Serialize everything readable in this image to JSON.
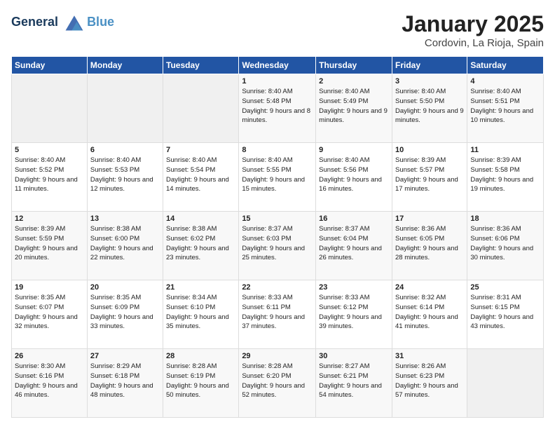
{
  "logo": {
    "line1": "General",
    "line2": "Blue"
  },
  "title": "January 2025",
  "location": "Cordovin, La Rioja, Spain",
  "days_of_week": [
    "Sunday",
    "Monday",
    "Tuesday",
    "Wednesday",
    "Thursday",
    "Friday",
    "Saturday"
  ],
  "weeks": [
    [
      {
        "day": "",
        "sunrise": "",
        "sunset": "",
        "daylight": ""
      },
      {
        "day": "",
        "sunrise": "",
        "sunset": "",
        "daylight": ""
      },
      {
        "day": "",
        "sunrise": "",
        "sunset": "",
        "daylight": ""
      },
      {
        "day": "1",
        "sunrise": "Sunrise: 8:40 AM",
        "sunset": "Sunset: 5:48 PM",
        "daylight": "Daylight: 9 hours and 8 minutes."
      },
      {
        "day": "2",
        "sunrise": "Sunrise: 8:40 AM",
        "sunset": "Sunset: 5:49 PM",
        "daylight": "Daylight: 9 hours and 9 minutes."
      },
      {
        "day": "3",
        "sunrise": "Sunrise: 8:40 AM",
        "sunset": "Sunset: 5:50 PM",
        "daylight": "Daylight: 9 hours and 9 minutes."
      },
      {
        "day": "4",
        "sunrise": "Sunrise: 8:40 AM",
        "sunset": "Sunset: 5:51 PM",
        "daylight": "Daylight: 9 hours and 10 minutes."
      }
    ],
    [
      {
        "day": "5",
        "sunrise": "Sunrise: 8:40 AM",
        "sunset": "Sunset: 5:52 PM",
        "daylight": "Daylight: 9 hours and 11 minutes."
      },
      {
        "day": "6",
        "sunrise": "Sunrise: 8:40 AM",
        "sunset": "Sunset: 5:53 PM",
        "daylight": "Daylight: 9 hours and 12 minutes."
      },
      {
        "day": "7",
        "sunrise": "Sunrise: 8:40 AM",
        "sunset": "Sunset: 5:54 PM",
        "daylight": "Daylight: 9 hours and 14 minutes."
      },
      {
        "day": "8",
        "sunrise": "Sunrise: 8:40 AM",
        "sunset": "Sunset: 5:55 PM",
        "daylight": "Daylight: 9 hours and 15 minutes."
      },
      {
        "day": "9",
        "sunrise": "Sunrise: 8:40 AM",
        "sunset": "Sunset: 5:56 PM",
        "daylight": "Daylight: 9 hours and 16 minutes."
      },
      {
        "day": "10",
        "sunrise": "Sunrise: 8:39 AM",
        "sunset": "Sunset: 5:57 PM",
        "daylight": "Daylight: 9 hours and 17 minutes."
      },
      {
        "day": "11",
        "sunrise": "Sunrise: 8:39 AM",
        "sunset": "Sunset: 5:58 PM",
        "daylight": "Daylight: 9 hours and 19 minutes."
      }
    ],
    [
      {
        "day": "12",
        "sunrise": "Sunrise: 8:39 AM",
        "sunset": "Sunset: 5:59 PM",
        "daylight": "Daylight: 9 hours and 20 minutes."
      },
      {
        "day": "13",
        "sunrise": "Sunrise: 8:38 AM",
        "sunset": "Sunset: 6:00 PM",
        "daylight": "Daylight: 9 hours and 22 minutes."
      },
      {
        "day": "14",
        "sunrise": "Sunrise: 8:38 AM",
        "sunset": "Sunset: 6:02 PM",
        "daylight": "Daylight: 9 hours and 23 minutes."
      },
      {
        "day": "15",
        "sunrise": "Sunrise: 8:37 AM",
        "sunset": "Sunset: 6:03 PM",
        "daylight": "Daylight: 9 hours and 25 minutes."
      },
      {
        "day": "16",
        "sunrise": "Sunrise: 8:37 AM",
        "sunset": "Sunset: 6:04 PM",
        "daylight": "Daylight: 9 hours and 26 minutes."
      },
      {
        "day": "17",
        "sunrise": "Sunrise: 8:36 AM",
        "sunset": "Sunset: 6:05 PM",
        "daylight": "Daylight: 9 hours and 28 minutes."
      },
      {
        "day": "18",
        "sunrise": "Sunrise: 8:36 AM",
        "sunset": "Sunset: 6:06 PM",
        "daylight": "Daylight: 9 hours and 30 minutes."
      }
    ],
    [
      {
        "day": "19",
        "sunrise": "Sunrise: 8:35 AM",
        "sunset": "Sunset: 6:07 PM",
        "daylight": "Daylight: 9 hours and 32 minutes."
      },
      {
        "day": "20",
        "sunrise": "Sunrise: 8:35 AM",
        "sunset": "Sunset: 6:09 PM",
        "daylight": "Daylight: 9 hours and 33 minutes."
      },
      {
        "day": "21",
        "sunrise": "Sunrise: 8:34 AM",
        "sunset": "Sunset: 6:10 PM",
        "daylight": "Daylight: 9 hours and 35 minutes."
      },
      {
        "day": "22",
        "sunrise": "Sunrise: 8:33 AM",
        "sunset": "Sunset: 6:11 PM",
        "daylight": "Daylight: 9 hours and 37 minutes."
      },
      {
        "day": "23",
        "sunrise": "Sunrise: 8:33 AM",
        "sunset": "Sunset: 6:12 PM",
        "daylight": "Daylight: 9 hours and 39 minutes."
      },
      {
        "day": "24",
        "sunrise": "Sunrise: 8:32 AM",
        "sunset": "Sunset: 6:14 PM",
        "daylight": "Daylight: 9 hours and 41 minutes."
      },
      {
        "day": "25",
        "sunrise": "Sunrise: 8:31 AM",
        "sunset": "Sunset: 6:15 PM",
        "daylight": "Daylight: 9 hours and 43 minutes."
      }
    ],
    [
      {
        "day": "26",
        "sunrise": "Sunrise: 8:30 AM",
        "sunset": "Sunset: 6:16 PM",
        "daylight": "Daylight: 9 hours and 46 minutes."
      },
      {
        "day": "27",
        "sunrise": "Sunrise: 8:29 AM",
        "sunset": "Sunset: 6:18 PM",
        "daylight": "Daylight: 9 hours and 48 minutes."
      },
      {
        "day": "28",
        "sunrise": "Sunrise: 8:28 AM",
        "sunset": "Sunset: 6:19 PM",
        "daylight": "Daylight: 9 hours and 50 minutes."
      },
      {
        "day": "29",
        "sunrise": "Sunrise: 8:28 AM",
        "sunset": "Sunset: 6:20 PM",
        "daylight": "Daylight: 9 hours and 52 minutes."
      },
      {
        "day": "30",
        "sunrise": "Sunrise: 8:27 AM",
        "sunset": "Sunset: 6:21 PM",
        "daylight": "Daylight: 9 hours and 54 minutes."
      },
      {
        "day": "31",
        "sunrise": "Sunrise: 8:26 AM",
        "sunset": "Sunset: 6:23 PM",
        "daylight": "Daylight: 9 hours and 57 minutes."
      },
      {
        "day": "",
        "sunrise": "",
        "sunset": "",
        "daylight": ""
      }
    ]
  ]
}
